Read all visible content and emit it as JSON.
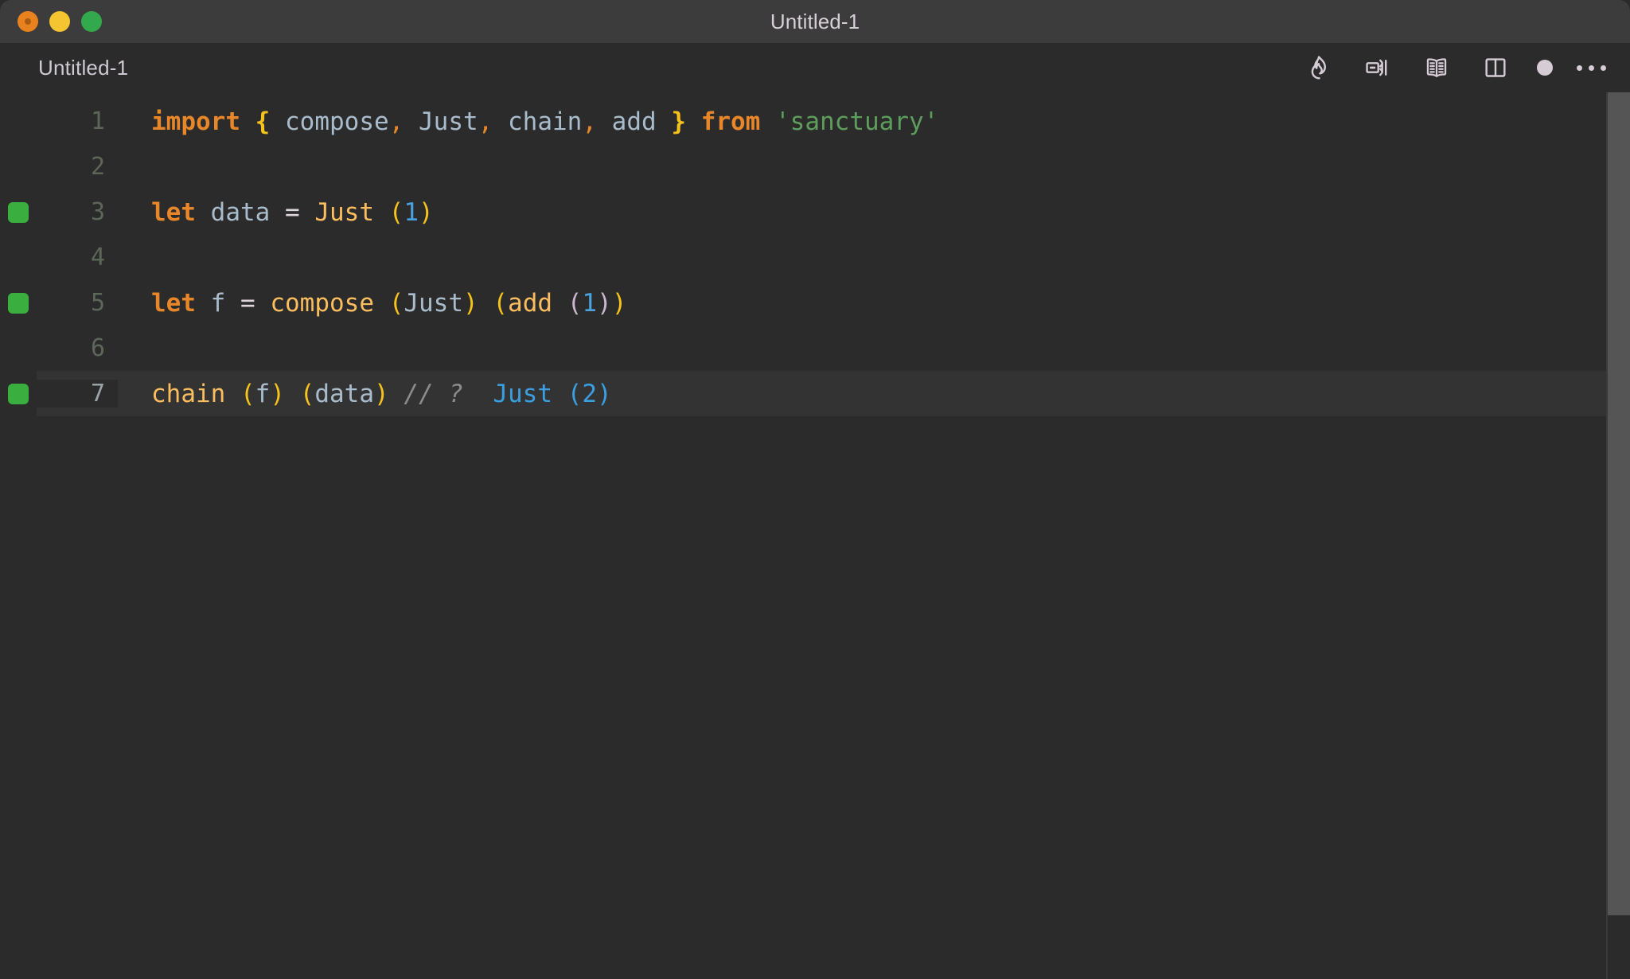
{
  "window": {
    "title": "Untitled-1",
    "traffic_lights": [
      {
        "name": "close",
        "color": "#e8821e"
      },
      {
        "name": "minimize",
        "color": "#f5c431"
      },
      {
        "name": "maximize",
        "color": "#32a94c"
      }
    ]
  },
  "tabbar": {
    "tab_label": "Untitled-1",
    "actions": [
      {
        "name": "flame-icon",
        "label": "Run Quokka"
      },
      {
        "name": "run-inline-icon",
        "label": "Run Code"
      },
      {
        "name": "open-preview-icon",
        "label": "Open Preview"
      },
      {
        "name": "split-editor-icon",
        "label": "Split Editor Right"
      },
      {
        "name": "unsaved-dot-icon",
        "label": "Unsaved Changes"
      },
      {
        "name": "more-actions-icon",
        "label": "More Actions..."
      }
    ]
  },
  "editor": {
    "language": "javascript",
    "active_line": 7,
    "marker_color": "#3aae3f",
    "lines": [
      {
        "number": "1",
        "marker": false,
        "active": false,
        "tokens": [
          {
            "t": "import",
            "c": "t-kw"
          },
          {
            "t": " ",
            "c": "t-op"
          },
          {
            "t": "{",
            "c": "t-brace"
          },
          {
            "t": " ",
            "c": "t-op"
          },
          {
            "t": "compose",
            "c": "t-var"
          },
          {
            "t": ",",
            "c": "t-punc"
          },
          {
            "t": " ",
            "c": "t-op"
          },
          {
            "t": "Just",
            "c": "t-var"
          },
          {
            "t": ",",
            "c": "t-punc"
          },
          {
            "t": " ",
            "c": "t-op"
          },
          {
            "t": "chain",
            "c": "t-var"
          },
          {
            "t": ",",
            "c": "t-punc"
          },
          {
            "t": " ",
            "c": "t-op"
          },
          {
            "t": "add",
            "c": "t-var"
          },
          {
            "t": " ",
            "c": "t-op"
          },
          {
            "t": "}",
            "c": "t-brace"
          },
          {
            "t": " ",
            "c": "t-op"
          },
          {
            "t": "from",
            "c": "t-kw"
          },
          {
            "t": " ",
            "c": "t-op"
          },
          {
            "t": "'sanctuary'",
            "c": "t-str"
          }
        ]
      },
      {
        "number": "2",
        "marker": false,
        "active": false,
        "tokens": []
      },
      {
        "number": "3",
        "marker": true,
        "active": false,
        "tokens": [
          {
            "t": "let",
            "c": "t-kw"
          },
          {
            "t": " ",
            "c": "t-op"
          },
          {
            "t": "data",
            "c": "t-var"
          },
          {
            "t": " ",
            "c": "t-op"
          },
          {
            "t": "=",
            "c": "t-op"
          },
          {
            "t": " ",
            "c": "t-op"
          },
          {
            "t": "Just",
            "c": "t-fn"
          },
          {
            "t": " ",
            "c": "t-op"
          },
          {
            "t": "(",
            "c": "t-b1"
          },
          {
            "t": "1",
            "c": "t-num"
          },
          {
            "t": ")",
            "c": "t-b1"
          }
        ]
      },
      {
        "number": "4",
        "marker": false,
        "active": false,
        "tokens": []
      },
      {
        "number": "5",
        "marker": true,
        "active": false,
        "tokens": [
          {
            "t": "let",
            "c": "t-kw"
          },
          {
            "t": " ",
            "c": "t-op"
          },
          {
            "t": "f",
            "c": "t-var"
          },
          {
            "t": " ",
            "c": "t-op"
          },
          {
            "t": "=",
            "c": "t-op"
          },
          {
            "t": " ",
            "c": "t-op"
          },
          {
            "t": "compose",
            "c": "t-fn"
          },
          {
            "t": " ",
            "c": "t-op"
          },
          {
            "t": "(",
            "c": "t-b1"
          },
          {
            "t": "Just",
            "c": "t-var"
          },
          {
            "t": ")",
            "c": "t-b1"
          },
          {
            "t": " ",
            "c": "t-op"
          },
          {
            "t": "(",
            "c": "t-b1"
          },
          {
            "t": "add",
            "c": "t-fn"
          },
          {
            "t": " ",
            "c": "t-op"
          },
          {
            "t": "(",
            "c": "t-b2"
          },
          {
            "t": "1",
            "c": "t-num"
          },
          {
            "t": ")",
            "c": "t-b2"
          },
          {
            "t": ")",
            "c": "t-b1"
          }
        ]
      },
      {
        "number": "6",
        "marker": false,
        "active": false,
        "tokens": []
      },
      {
        "number": "7",
        "marker": true,
        "active": true,
        "tokens": [
          {
            "t": "chain",
            "c": "t-fn"
          },
          {
            "t": " ",
            "c": "t-op"
          },
          {
            "t": "(",
            "c": "t-b1"
          },
          {
            "t": "f",
            "c": "t-var"
          },
          {
            "t": ")",
            "c": "t-b1"
          },
          {
            "t": " ",
            "c": "t-op"
          },
          {
            "t": "(",
            "c": "t-b1"
          },
          {
            "t": "data",
            "c": "t-var"
          },
          {
            "t": ")",
            "c": "t-b1"
          },
          {
            "t": " ",
            "c": "t-op"
          },
          {
            "t": "// ?",
            "c": "t-comment"
          },
          {
            "t": "  ",
            "c": "t-op"
          },
          {
            "t": "Just (2)",
            "c": "t-result"
          }
        ]
      }
    ]
  },
  "scrollbar": {
    "name": "vertical-scrollbar",
    "thumb_color": "#555555"
  }
}
